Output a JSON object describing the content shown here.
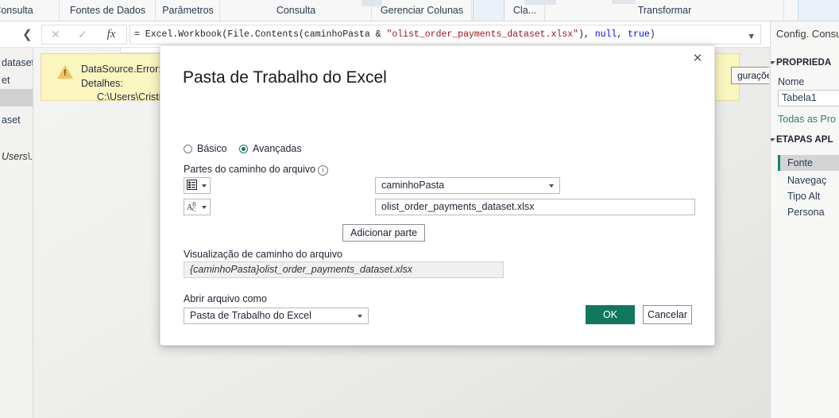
{
  "ribbon": {
    "groups": [
      {
        "label": "Consulta"
      },
      {
        "label": "Fontes de Dados"
      },
      {
        "label": "Parâmetros"
      },
      {
        "label": "Consulta"
      },
      {
        "label": "Gerenciar Colunas"
      },
      {
        "label": "Cla..."
      },
      {
        "label": "Transformar"
      }
    ]
  },
  "formula_bar": {
    "cancel_icon": "close-icon",
    "accept_icon": "check-icon",
    "fx_label": "fx",
    "expand_icon": "chevron-down-icon",
    "collapse_icon": "chevron-left-icon",
    "text_prefix": "= Excel.Workbook(File.Contents(caminhoPasta & ",
    "text_string": "\"olist_order_payments_dataset.xlsx\"",
    "text_mid": "), ",
    "text_kw1": "null",
    "text_comma": ", ",
    "text_kw2": "true",
    "text_suffix": ")"
  },
  "queries_pane": {
    "items": [
      {
        "label": "dataset",
        "selected": false,
        "italic": false
      },
      {
        "label": "et",
        "selected": false,
        "italic": false
      },
      {
        "label": "",
        "selected": true,
        "italic": false
      },
      {
        "label": "aset",
        "selected": false,
        "italic": false
      },
      {
        "label": "Users\\...",
        "selected": false,
        "italic": true
      }
    ]
  },
  "error_banner": {
    "warning_icon": "warning-triangle-icon",
    "line1": "DataSource.Error: Na",
    "line2": "Detalhes:",
    "line3": "C:\\Users\\Cristiano",
    "config_button": "gurações"
  },
  "settings_pane": {
    "title": "Config. Consu",
    "section_properties": "PROPRIEDA",
    "name_label": "Nome",
    "name_value": "Tabela1",
    "all_properties_link": "Todas as Pro",
    "section_steps": "ETAPAS APL",
    "steps": [
      {
        "label": "Fonte",
        "selected": true
      },
      {
        "label": "Navegaç",
        "selected": false
      },
      {
        "label": "Tipo Alt",
        "selected": false
      },
      {
        "label": "Persona",
        "selected": false
      }
    ]
  },
  "dialog": {
    "title": "Pasta de Trabalho do Excel",
    "close_icon": "close-icon",
    "mode_basic_label": "Básico",
    "mode_basic_selected": false,
    "mode_advanced_label": "Avançadas",
    "mode_advanced_selected": true,
    "parts_label": "Partes do caminho do arquivo",
    "parts_info_icon": "info-icon",
    "part_rows": [
      {
        "type_icon": "parameter-icon",
        "value": "caminhoPasta",
        "kind": "combo"
      },
      {
        "type_icon": "abc-text-icon",
        "value": "olist_order_payments_dataset.xlsx",
        "kind": "text"
      }
    ],
    "add_part_button": "Adicionar parte",
    "preview_label": "Visualização de caminho do arquivo",
    "preview_value": "{caminhoPasta}olist_order_payments_dataset.xlsx",
    "open_as_label": "Abrir arquivo como",
    "open_as_value": "Pasta de Trabalho do Excel",
    "ok_button": "OK",
    "cancel_button": "Cancelar",
    "accent_color": "#12775f"
  }
}
